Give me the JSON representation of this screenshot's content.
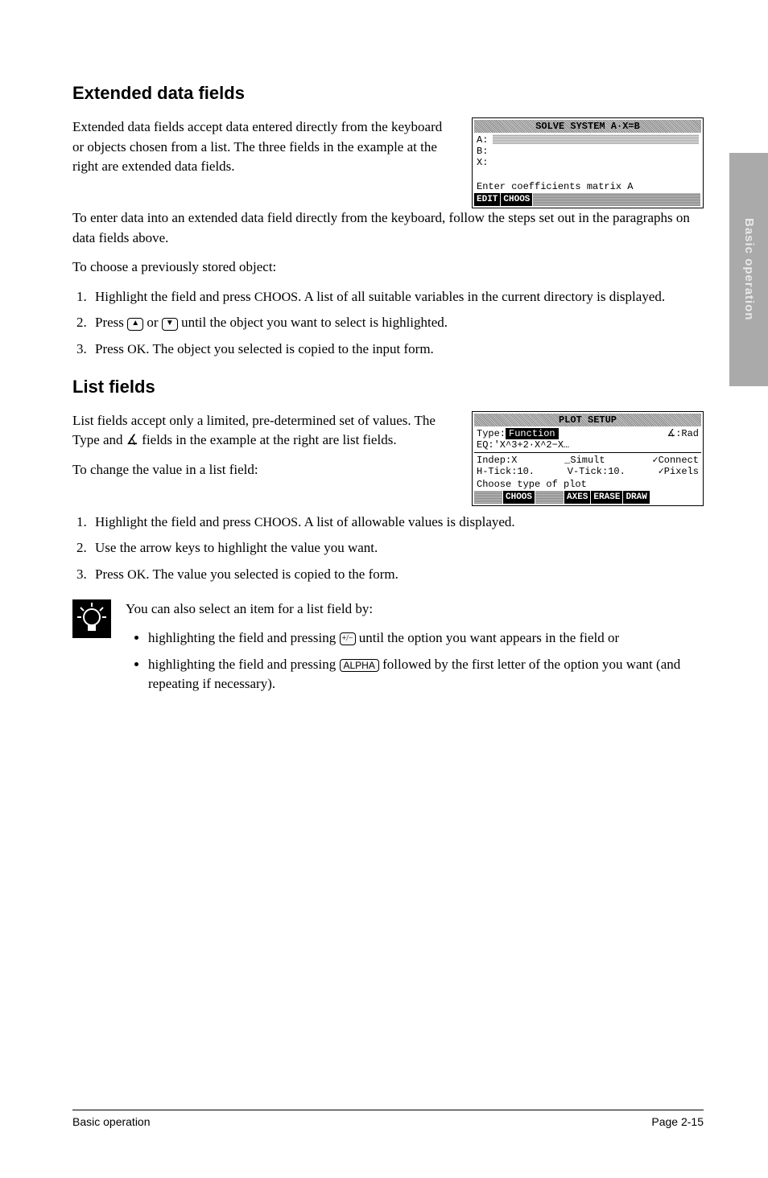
{
  "sideTab": "Basic operation",
  "headings": {
    "extended": "Extended data fields",
    "list": "List fields"
  },
  "extended": {
    "intro": "Extended data fields accept data entered directly from the keyboard or objects chosen from a list. The three fields in the example at the right are extended data fields.",
    "p2a": "To enter data into an extended data field directly from the keyboard, follow the steps set out in the paragraphs on data fields above.",
    "p3": "To choose a previously stored object:",
    "steps": {
      "s1a": "Highlight the field and press ",
      "s1b": ". A list of all suitable variables in the current directory is displayed.",
      "s2a": "Press ",
      "s2b": " or ",
      "s2c": " until the object you want to select is highlighted.",
      "s3a": "Press ",
      "s3b": ". The object you selected is copied to the input form."
    }
  },
  "listf": {
    "intro": "List fields accept only a limited, pre-determined set of values. The Type and ∡ fields in the example at the right are list fields.",
    "p2": "To change the value in a list field:",
    "steps": {
      "s1a": "Highlight the field and press ",
      "s1b": ". A list of allowable values is displayed.",
      "s2": "Use the arrow keys to highlight the value you want.",
      "s3a": "Press ",
      "s3b": ". The value you selected is copied to the form."
    }
  },
  "tip": {
    "lead": "You can also select an item for a list field by:",
    "b1a": "highlighting the field and pressing ",
    "b1b": " until the option you want appears in the field or",
    "b2a": "highlighting the field and pressing ",
    "b2b": " followed by the first letter of the option you want (and repeating if necessary)."
  },
  "keys": {
    "choos": "CHOOS",
    "ok": "OK",
    "up": "▲",
    "down": "▼",
    "plusminus": "+/−",
    "alpha": "ALPHA"
  },
  "screen1": {
    "title": "SOLVE SYSTEM A·X=B",
    "rows": {
      "a": "A:",
      "b": "B:",
      "x": "X:"
    },
    "help": "Enter coefficients matrix A",
    "menu": {
      "m1": "EDIT",
      "m2": "CHOOS"
    }
  },
  "screen2": {
    "title": "PLOT SETUP",
    "typeLabel": "Type:",
    "typeValue": "Function",
    "angle": "∡:Rad",
    "eq": "EQ:'X^3+2·X^2−X…",
    "indep": "Indep:X",
    "simult": "_Simult",
    "connect": "✓Connect",
    "htick": "H-Tick:10.",
    "vtick": "V-Tick:10.",
    "pixels": "✓Pixels",
    "help": "Choose type of plot",
    "menu": {
      "m1": "CHOOS",
      "m2": "AXES",
      "m3": "ERASE",
      "m4": "DRAW"
    }
  },
  "footer": {
    "left": "Basic operation",
    "right": "Page 2-15"
  }
}
